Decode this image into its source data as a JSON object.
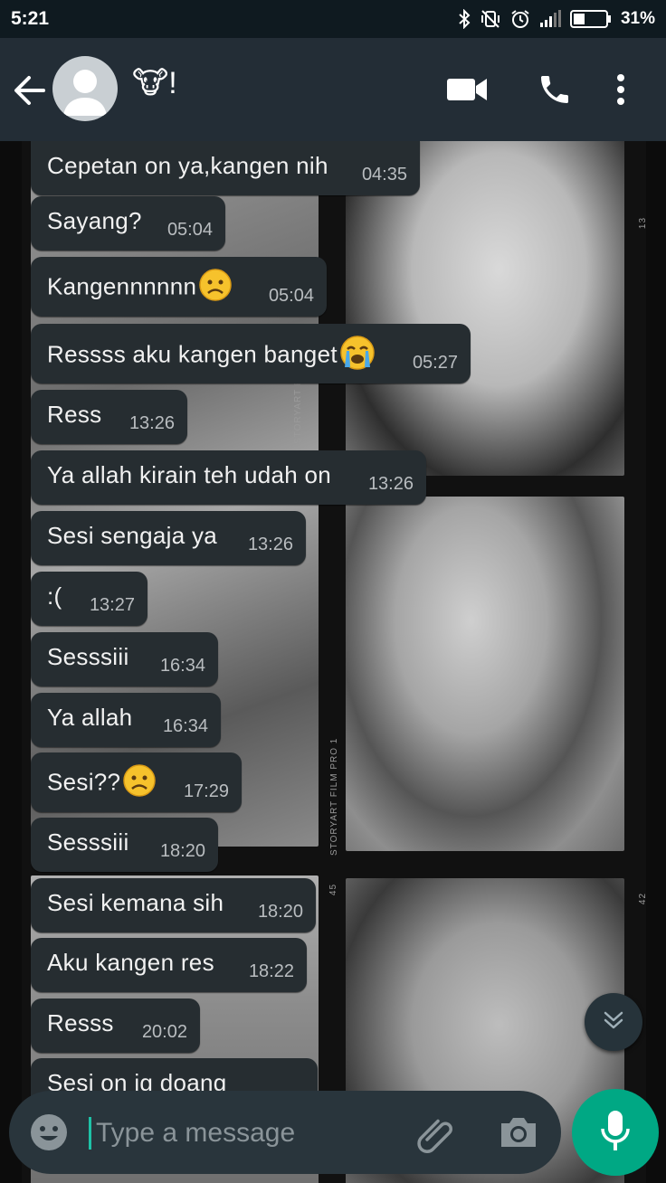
{
  "status_bar": {
    "time": "5:21",
    "battery": "31%"
  },
  "header": {
    "contact_name": "🐮!"
  },
  "messages": [
    {
      "text": "Cepetan on ya,kangen nih",
      "time": "04:35"
    },
    {
      "text": "Sayang?",
      "time": "05:04"
    },
    {
      "text": "Kangennnnnn",
      "emoji": "sad-face",
      "time": "05:04"
    },
    {
      "text": "Ressss aku kangen banget",
      "emoji": "crying-face",
      "time": "05:27"
    },
    {
      "text": "Ress",
      "time": "13:26"
    },
    {
      "text": "Ya allah kirain teh udah on",
      "time": "13:26"
    },
    {
      "text": "Sesi sengaja ya",
      "time": "13:26"
    },
    {
      "text": ":(",
      "time": "13:27"
    },
    {
      "text": "Sesssiii",
      "time": "16:34"
    },
    {
      "text": "Ya allah",
      "time": "16:34"
    },
    {
      "text": "Sesi??",
      "emoji": "sad-face",
      "time": "17:29"
    },
    {
      "text": "Sesssiii",
      "time": "18:20"
    },
    {
      "text": "Sesi kemana sih",
      "time": "18:20"
    },
    {
      "text": "Aku kangen res",
      "time": "18:22"
    },
    {
      "text": "Resss",
      "time": "20:02"
    },
    {
      "text": "Sesi on ig doang",
      "time": ""
    }
  ],
  "wallpaper": {
    "film_label_1": "STORYART FILM",
    "film_label_2": "STORYART FILM PRO 1",
    "frame_number_1": "13",
    "frame_number_2": "45",
    "frame_number_3": "42"
  },
  "composer": {
    "placeholder": "Type a message"
  },
  "colors": {
    "header": "#232d36",
    "bubble": "#262d31",
    "accent": "#00a884"
  }
}
